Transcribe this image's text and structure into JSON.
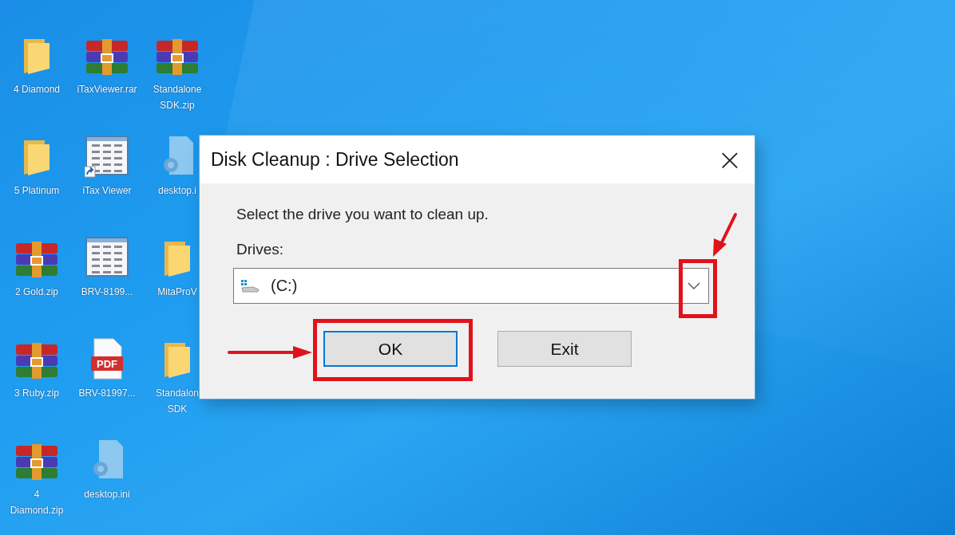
{
  "desktop_icons": [
    {
      "kind": "folder",
      "label": "4 Diamond"
    },
    {
      "kind": "folder",
      "label": "5 Platinum"
    },
    {
      "kind": "archive",
      "label": "2 Gold.zip"
    },
    {
      "kind": "archive",
      "label": "3 Ruby.zip"
    },
    {
      "kind": "archive",
      "label": "4 Diamond.zip"
    },
    {
      "kind": "archive",
      "label": "iTaxViewer.rar"
    },
    {
      "kind": "sheet",
      "label": "iTax Viewer",
      "shortcut": true
    },
    {
      "kind": "sheet",
      "label": "BRV-8199..."
    },
    {
      "kind": "pdf",
      "label": "BRV-81997...",
      "badge": "PDF"
    },
    {
      "kind": "ini",
      "label": "desktop.ini"
    },
    {
      "kind": "archive",
      "label": "Standalone SDK.zip"
    },
    {
      "kind": "ini",
      "label": "desktop.i"
    },
    {
      "kind": "folder",
      "label": "MitaProV"
    },
    {
      "kind": "folder",
      "label": "Standalon SDK"
    }
  ],
  "dialog": {
    "title": "Disk Cleanup : Drive Selection",
    "close": "×",
    "prompt": "Select the drive you want to clean up.",
    "drives_label": "Drives:",
    "drive": {
      "value": "(C:)"
    },
    "buttons": [
      {
        "label": "OK",
        "focused": true
      },
      {
        "label": "Exit",
        "focused": false
      }
    ]
  }
}
